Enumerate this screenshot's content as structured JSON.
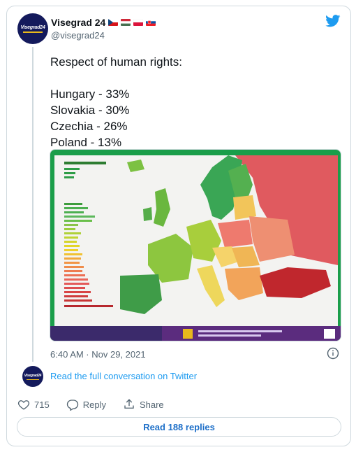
{
  "author": {
    "display_name": "Visegrad 24",
    "handle": "@visegrad24",
    "avatar_text": "Visegrad24",
    "flags": [
      "czech-flag",
      "hungary-flag",
      "poland-flag",
      "slovakia-flag"
    ]
  },
  "tweet": {
    "lines": [
      "Respect of human rights:",
      "",
      "Hungary - 33%",
      "Slovakia - 30%",
      "Czechia - 26%",
      "Poland - 13%"
    ],
    "image_alt": "Rainbow Europe map with country percentages",
    "timestamp": "6:40 AM · Nov 29, 2021"
  },
  "conversation_link": "Read the full conversation on Twitter",
  "actions": {
    "like_count": "715",
    "reply_label": "Reply",
    "share_label": "Share"
  },
  "read_replies_label": "Read 188 replies",
  "colors": {
    "twitter_blue": "#1d9bf0",
    "muted": "#536471",
    "border": "#cfd9de",
    "avatar_bg": "#141a5c"
  }
}
